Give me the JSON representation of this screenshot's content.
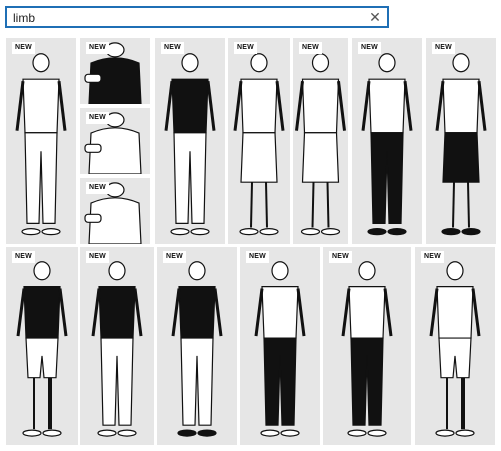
{
  "search": {
    "value": "limb",
    "clear_icon": "close-icon"
  },
  "tiles": [
    {
      "badge": "NEW",
      "figure": "full-body-white-shirt-prosthetic-arm"
    },
    {
      "badge": "NEW",
      "figure": "upper-body-black-blouse-prosthetic-arm"
    },
    {
      "badge": "NEW",
      "figure": "upper-body-polo-phone-prosthetic-arm"
    },
    {
      "badge": "NEW",
      "figure": "upper-body-tshirt-cup-prosthetic-arm"
    },
    {
      "badge": "NEW",
      "figure": "full-body-black-shirt-prosthetic-arm"
    },
    {
      "badge": "NEW",
      "figure": "full-body-dress-belt-prosthetic-arm"
    },
    {
      "badge": "NEW",
      "figure": "full-body-woman-dress-prosthetic-arm"
    },
    {
      "badge": "NEW",
      "figure": "full-body-white-shirt-black-pants-prosthetic-arm"
    },
    {
      "badge": "NEW",
      "figure": "full-body-black-skirt-prosthetic-arm"
    },
    {
      "badge": "NEW",
      "figure": "full-body-black-shirt-shorts-prosthetic-leg"
    },
    {
      "badge": "NEW",
      "figure": "full-body-black-tshirt-prosthetic-arm"
    },
    {
      "badge": "NEW",
      "figure": "full-body-black-shirt-sneakers-prosthetic-arm"
    },
    {
      "badge": "NEW",
      "figure": "full-body-white-tshirt-black-jeans-prosthetic-arm"
    },
    {
      "badge": "NEW",
      "figure": "full-body-jacket-prosthetic-leg"
    },
    {
      "badge": "NEW",
      "figure": "full-body-white-shirt-shorts-prosthetic-leg"
    }
  ]
}
